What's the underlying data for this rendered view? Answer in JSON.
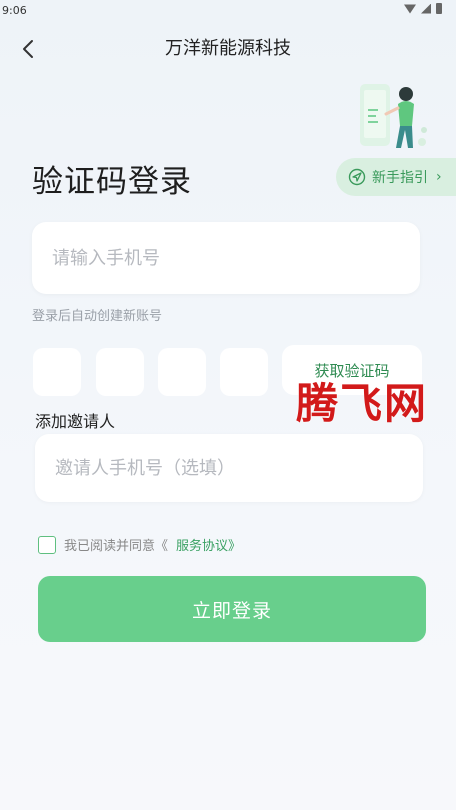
{
  "status_bar": {
    "time": "9:06"
  },
  "header": {
    "title": "万洋新能源科技"
  },
  "guide": {
    "label": "新手指引"
  },
  "page": {
    "heading": "验证码登录"
  },
  "phone": {
    "placeholder": "请输入手机号"
  },
  "hint": "登录后自动创建新账号",
  "code": {
    "get_code_label": "获取验证码",
    "box_count": 4
  },
  "watermark": "腾飞网",
  "invite": {
    "label": "添加邀请人",
    "placeholder": "邀请人手机号（选填）"
  },
  "agreement": {
    "text": "我已阅读并同意《",
    "link": "服务协议》"
  },
  "login_button": "立即登录",
  "colors": {
    "accent": "#68cf8c",
    "link": "#3aa163",
    "watermark": "#d21a1a"
  }
}
